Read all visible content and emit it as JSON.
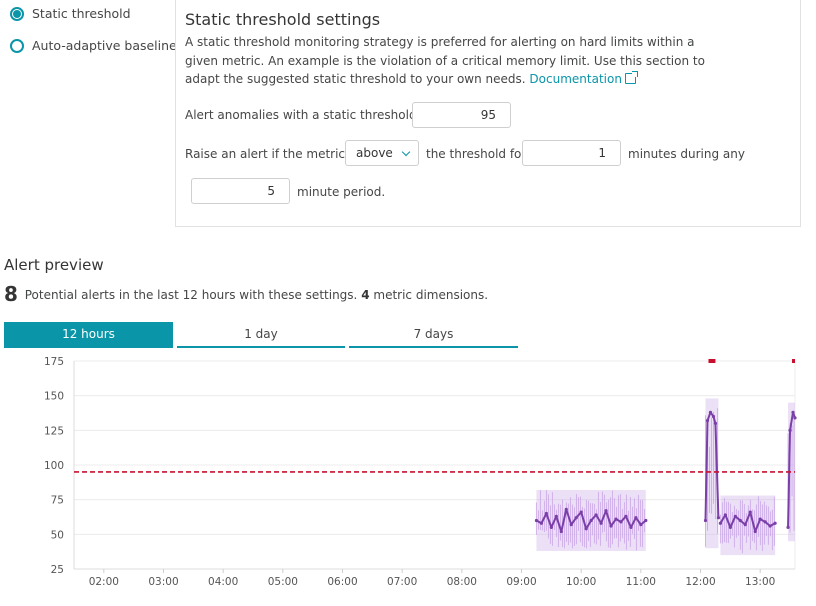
{
  "strategy": {
    "options": [
      {
        "label": "Static threshold",
        "selected": true
      },
      {
        "label": "Auto-adaptive baseline",
        "selected": false
      }
    ]
  },
  "settings": {
    "title": "Static threshold settings",
    "description": "A static threshold monitoring strategy is preferred for alerting on hard limits within a given metric. An example is the violation of a critical memory limit. Use this section to adapt the suggested static threshold to your own needs.",
    "doc_link": "Documentation",
    "threshold_label": "Alert anomalies with a static threshold of",
    "threshold_value": "95",
    "raise_label": "Raise an alert if the metric is",
    "condition": "above",
    "threshold_for_label": "the threshold for",
    "minutes_value": "1",
    "minutes_during_label": "minutes during any",
    "period_value": "5",
    "period_label": "minute period."
  },
  "preview": {
    "title": "Alert preview",
    "count": "8",
    "text_before": "Potential alerts in the last 12 hours with these settings.",
    "dimensions_count": "4",
    "dimensions_label": "metric dimensions.",
    "tabs": [
      {
        "label": "12 hours",
        "active": true
      },
      {
        "label": "1 day",
        "active": false
      },
      {
        "label": "7 days",
        "active": false
      }
    ]
  },
  "colors": {
    "accent": "#0a95a8",
    "series": "#7b3fa8",
    "band": "#c9a6e6",
    "threshold": "#c8102e"
  },
  "chart_data": {
    "type": "line",
    "ylim": [
      25,
      175
    ],
    "yticks": [
      25,
      50,
      75,
      100,
      125,
      150,
      175
    ],
    "xlim": [
      "01:30",
      "13:35"
    ],
    "xticks": [
      "02:00",
      "03:00",
      "04:00",
      "05:00",
      "06:00",
      "07:00",
      "08:00",
      "09:00",
      "10:00",
      "11:00",
      "12:00",
      "13:00"
    ],
    "threshold": 95,
    "segments": [
      {
        "x": [
          "09:15",
          "09:20",
          "09:25",
          "09:30",
          "09:35",
          "09:40",
          "09:45",
          "09:50",
          "09:55",
          "10:00",
          "10:05",
          "10:10",
          "10:15",
          "10:20",
          "10:25",
          "10:30",
          "10:35",
          "10:40",
          "10:45",
          "10:50",
          "10:55",
          "11:00",
          "11:05"
        ],
        "y": [
          60,
          58,
          65,
          55,
          63,
          52,
          68,
          57,
          62,
          66,
          54,
          60,
          64,
          58,
          67,
          56,
          61,
          59,
          63,
          55,
          62,
          57,
          60
        ]
      },
      {
        "x": [
          "12:05",
          "12:07",
          "12:10",
          "12:13",
          "12:15",
          "12:18"
        ],
        "y": [
          60,
          132,
          138,
          135,
          130,
          62
        ]
      },
      {
        "x": [
          "12:20",
          "12:25",
          "12:30",
          "12:35",
          "12:40",
          "12:45",
          "12:50",
          "12:55",
          "13:00",
          "13:05",
          "13:10",
          "13:15"
        ],
        "y": [
          58,
          64,
          55,
          63,
          60,
          57,
          66,
          52,
          61,
          59,
          56,
          58
        ]
      },
      {
        "x": [
          "13:28",
          "13:30",
          "13:33",
          "13:35"
        ],
        "y": [
          55,
          125,
          138,
          134
        ]
      }
    ],
    "bands": [
      {
        "x": [
          "09:15",
          "11:05"
        ],
        "low": 38,
        "high": 82
      },
      {
        "x": [
          "12:05",
          "12:18"
        ],
        "low": 40,
        "high": 148
      },
      {
        "x": [
          "12:20",
          "13:15"
        ],
        "low": 35,
        "high": 78
      },
      {
        "x": [
          "13:28",
          "13:35"
        ],
        "low": 45,
        "high": 145
      }
    ],
    "alert_markers": [
      {
        "x": [
          "12:08",
          "12:15"
        ],
        "y": 175
      },
      {
        "x": [
          "13:32",
          "13:35"
        ],
        "y": 175
      }
    ]
  }
}
